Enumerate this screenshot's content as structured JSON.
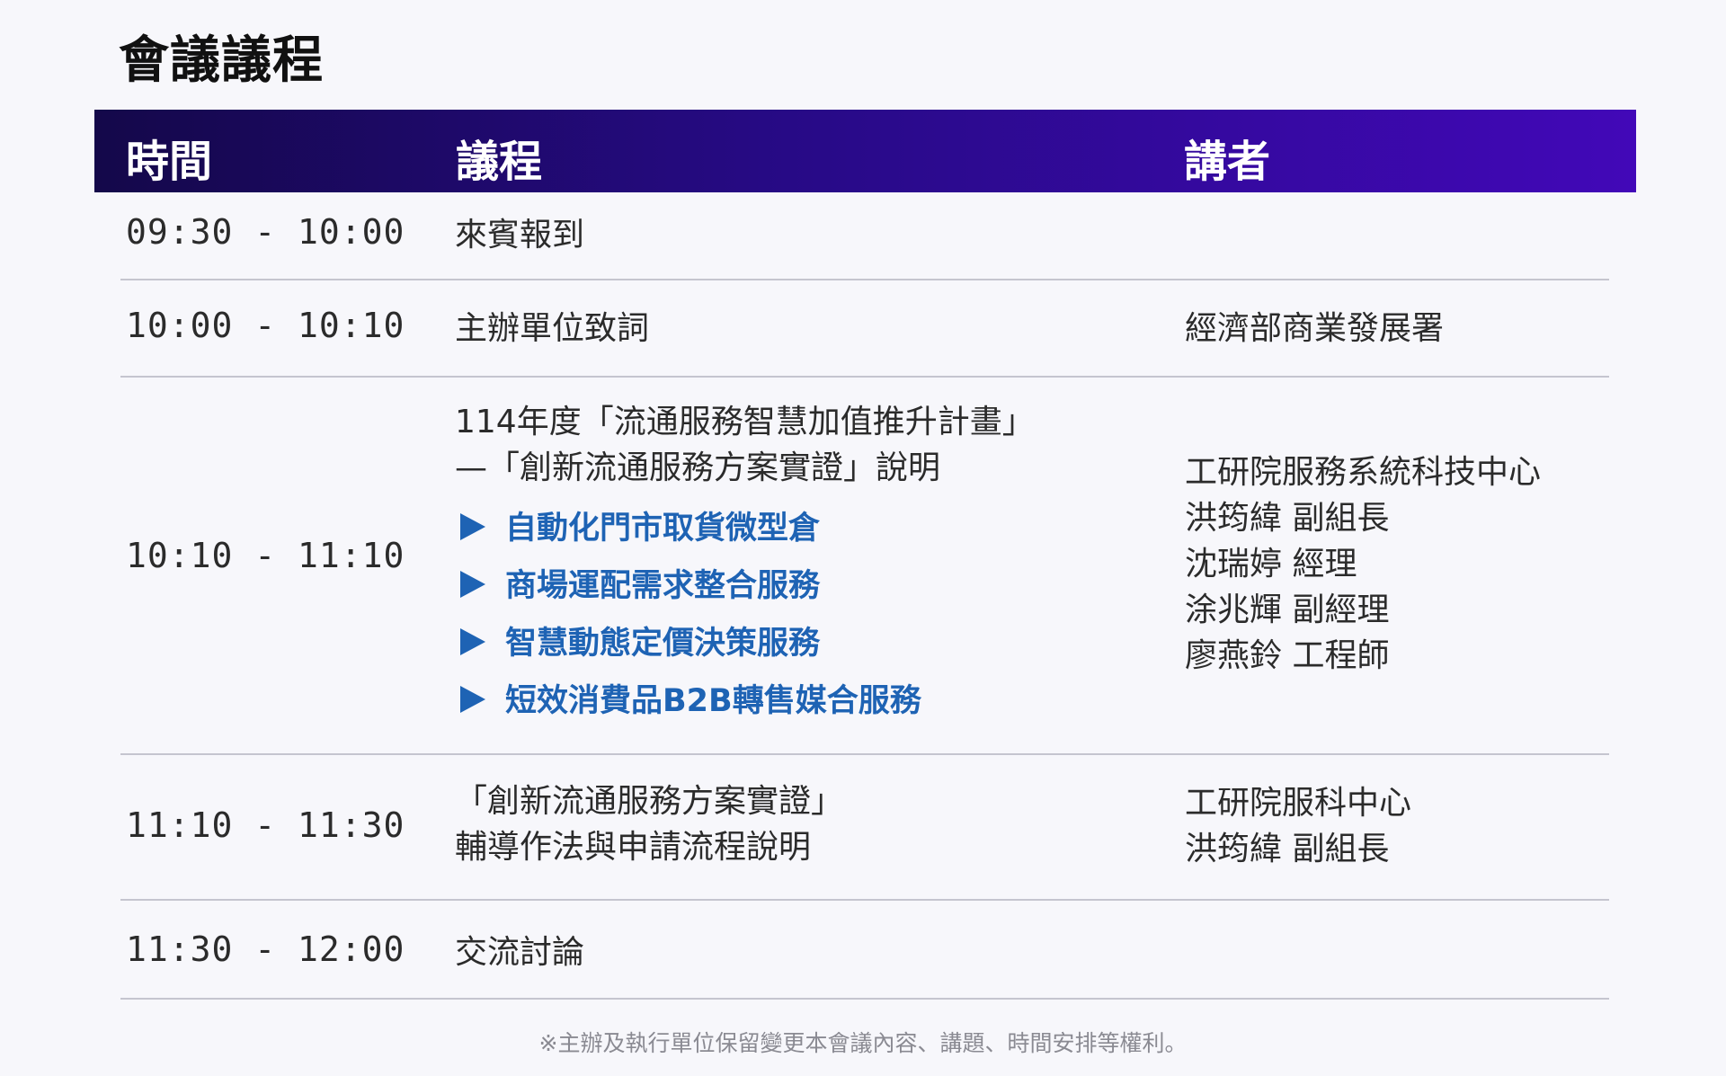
{
  "page": {
    "title": "會議議程"
  },
  "table": {
    "headers": {
      "time": "時間",
      "topic": "議程",
      "speaker": "講者"
    },
    "rows": [
      {
        "time": "09:30 - 10:00",
        "topic_lines": [
          "來賓報到"
        ],
        "speaker_lines": []
      },
      {
        "time": "10:00 - 10:10",
        "topic_lines": [
          "主辦單位致詞"
        ],
        "speaker_lines": [
          "經濟部商業發展署"
        ]
      },
      {
        "time": "10:10 - 11:10",
        "topic_lines": [
          "114年度「流通服務智慧加值推升計畫」",
          "—「創新流通服務方案實證」說明"
        ],
        "sub_items": [
          "自動化門市取貨微型倉",
          "商場運配需求整合服務",
          "智慧動態定價決策服務",
          "短效消費品B2B轉售媒合服務"
        ],
        "speaker_lines": [
          "工研院服務系統科技中心",
          "洪筠緯  副組長",
          "沈瑞婷  經理",
          "涂兆輝  副經理",
          "廖燕鈴  工程師"
        ]
      },
      {
        "time": "11:10 - 11:30",
        "topic_lines": [
          "「創新流通服務方案實證」",
          "輔導作法與申請流程說明"
        ],
        "speaker_lines": [
          "工研院服科中心",
          "洪筠緯  副組長"
        ]
      },
      {
        "time": "11:30 - 12:00",
        "topic_lines": [
          "交流討論"
        ],
        "speaker_lines": []
      }
    ]
  },
  "footnote": "※主辦及執行單位保留變更本會議內容、講題、時間安排等權利。",
  "colors": {
    "header_gradient_start": "#14084a",
    "header_gradient_end": "#4208b8",
    "sub_item_blue": "#1e63b4",
    "divider": "#c5c5cf"
  },
  "icons": {
    "sub_item_bullet": "play-triangle-icon"
  }
}
